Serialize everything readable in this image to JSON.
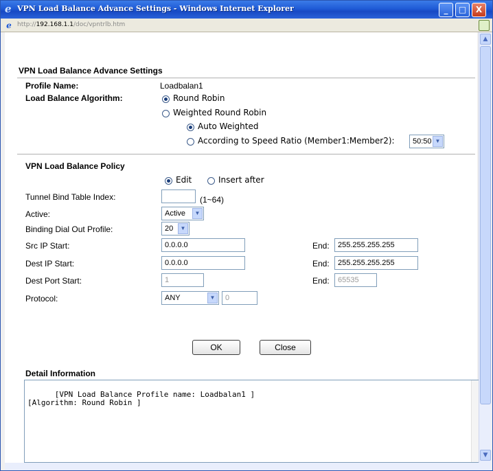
{
  "window": {
    "title": "VPN Load Balance Advance Settings - Windows Internet Explorer",
    "url_prefix": "http://",
    "url_host": "192.168.1.1",
    "url_path": "/doc/vpntrlb.htm",
    "minimize": "_",
    "maximize": "□",
    "close": "X"
  },
  "page": {
    "title": "VPN Load Balance Advance Settings",
    "profile_name_label": "Profile Name:",
    "profile_name_value": "Loadbalan1",
    "algorithm_label": "Load Balance Algorithm:",
    "round_robin": "Round Robin",
    "weighted_round_robin": "Weighted Round Robin",
    "auto_weighted": "Auto Weighted",
    "speed_ratio_label": "According to Speed Ratio (Member1:Member2):",
    "speed_ratio_value": "50:50",
    "policy_title": "VPN Load Balance Policy",
    "edit_label": "Edit",
    "insert_after_label": "Insert after",
    "tunnel_index_label": "Tunnel Bind Table Index:",
    "tunnel_index_value": "",
    "tunnel_index_range": "(1~64)",
    "active_label": "Active:",
    "active_value": "Active",
    "dial_out_label": "Binding Dial Out Profile:",
    "dial_out_value": "20",
    "src_ip_label": "Src IP Start:",
    "src_ip_start": "0.0.0.0",
    "src_ip_end": "255.255.255.255",
    "dest_ip_label": "Dest IP Start:",
    "dest_ip_start": "0.0.0.0",
    "dest_ip_end": "255.255.255.255",
    "dest_port_label": "Dest Port Start:",
    "dest_port_start": "1",
    "dest_port_end": "65535",
    "end_label": "End:",
    "protocol_label": "Protocol:",
    "protocol_value": "ANY",
    "protocol_port": "0",
    "ok_button": "OK",
    "close_button": "Close",
    "detail_title": "Detail Information",
    "detail_text": "[VPN Load Balance Profile name: Loadbalan1 ]\n[Algorithm: Round Robin ]"
  },
  "colors": {
    "titlebar": "#1f5bd6",
    "input_border": "#7f9db9"
  }
}
